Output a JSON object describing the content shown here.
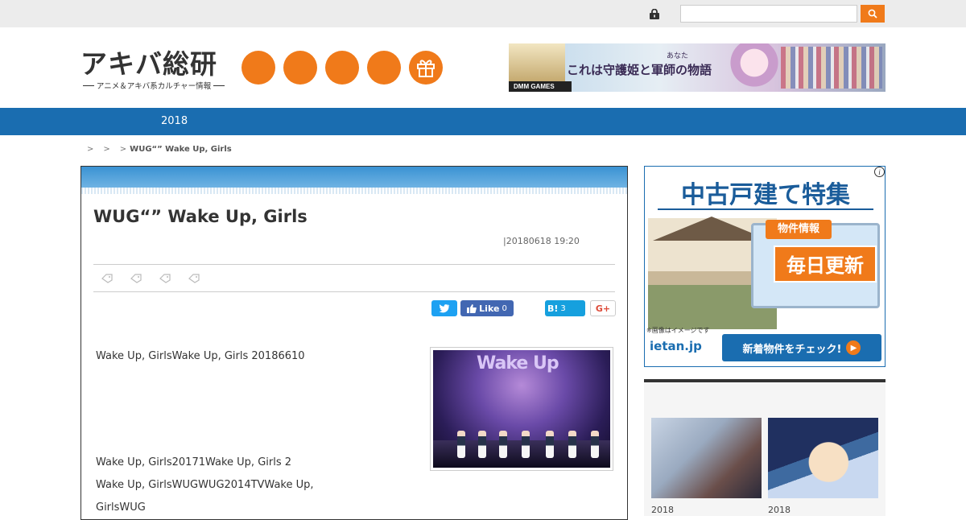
{
  "site": {
    "logo_text": "アキバ総研",
    "tagline": "アニメ＆アキバ系カルチャー情報",
    "search_placeholder": ""
  },
  "banner": {
    "brand": "DMM GAMES",
    "headline": "これは守護姫と軍師の物語",
    "small": "あなた"
  },
  "nav": {
    "items": [
      "2018"
    ]
  },
  "breadcrumb": {
    "separators": [
      ">",
      ">",
      ">"
    ],
    "current": "WUG“” Wake Up, Girls"
  },
  "article": {
    "title": "WUG“” Wake Up, Girls",
    "date": "|20180618 19:20",
    "share": {
      "facebook_label": "Like",
      "facebook_count": "0",
      "hatena_label": "B!",
      "hatena_count": "3"
    },
    "photo_sign": "Wake Up",
    "paragraphs": [
      "Wake Up, GirlsWake Up, Girls 20186610",
      "Wake Up, Girls20171Wake Up, Girls 2",
      "Wake Up, GirlsWUGWUG2014TVWake Up,",
      "GirlsWUG"
    ]
  },
  "ad": {
    "headline": "中古戸建て特集",
    "badge_small": "物件情報",
    "badge_big": "毎日更新",
    "note": "※画像はイメージです",
    "logo": "ietan.jp",
    "cta": "新着物件をチェック!"
  },
  "widget": {
    "title": "",
    "dates": [
      "2018",
      "2018"
    ]
  },
  "colors": {
    "accent": "#f07a1a",
    "nav": "#1a6db0"
  }
}
